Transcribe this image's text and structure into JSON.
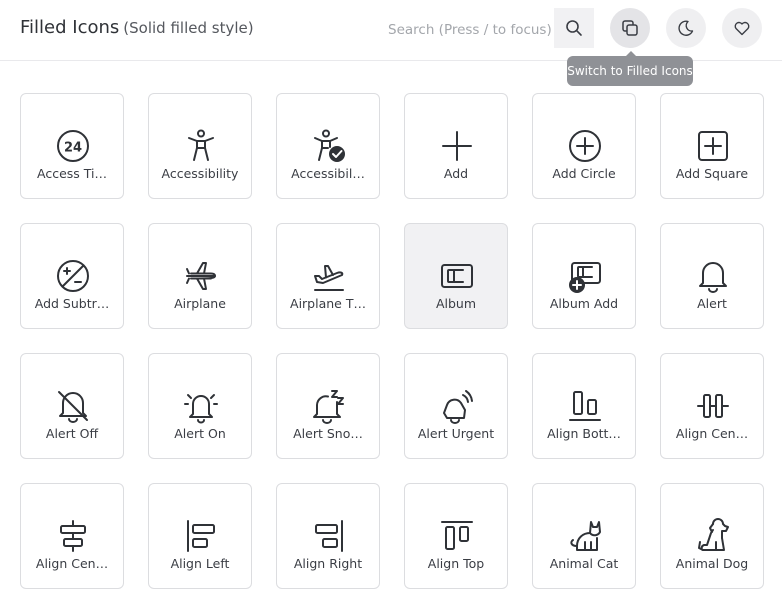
{
  "header": {
    "title": "Filled Icons",
    "subtitle": "(Solid filled style)",
    "search_placeholder": "Search (Press / to focus)",
    "tooltip": "Switch to Filled Icons"
  },
  "icons": [
    {
      "label": "Access Ti…",
      "icon": "access-time-24-icon"
    },
    {
      "label": "Accessibility",
      "icon": "accessibility-icon"
    },
    {
      "label": "Accessibil…",
      "icon": "accessibility-checkmark-icon"
    },
    {
      "label": "Add",
      "icon": "add-icon"
    },
    {
      "label": "Add Circle",
      "icon": "add-circle-icon"
    },
    {
      "label": "Add Square",
      "icon": "add-square-icon"
    },
    {
      "label": "Add Subtr…",
      "icon": "add-subtract-circle-icon"
    },
    {
      "label": "Airplane",
      "icon": "airplane-icon"
    },
    {
      "label": "Airplane T…",
      "icon": "airplane-take-off-icon"
    },
    {
      "label": "Album",
      "icon": "album-icon"
    },
    {
      "label": "Album Add",
      "icon": "album-add-icon"
    },
    {
      "label": "Alert",
      "icon": "alert-icon"
    },
    {
      "label": "Alert Off",
      "icon": "alert-off-icon"
    },
    {
      "label": "Alert On",
      "icon": "alert-on-icon"
    },
    {
      "label": "Alert Sno…",
      "icon": "alert-snooze-icon"
    },
    {
      "label": "Alert Urgent",
      "icon": "alert-urgent-icon"
    },
    {
      "label": "Align Bott…",
      "icon": "align-bottom-icon"
    },
    {
      "label": "Align Cen…",
      "icon": "align-center-horizontal-icon"
    },
    {
      "label": "Align Cen…",
      "icon": "align-center-vertical-icon"
    },
    {
      "label": "Align Left",
      "icon": "align-left-icon"
    },
    {
      "label": "Align Right",
      "icon": "align-right-icon"
    },
    {
      "label": "Align Top",
      "icon": "align-top-icon"
    },
    {
      "label": "Animal Cat",
      "icon": "animal-cat-icon"
    },
    {
      "label": "Animal Dog",
      "icon": "animal-dog-icon"
    }
  ]
}
